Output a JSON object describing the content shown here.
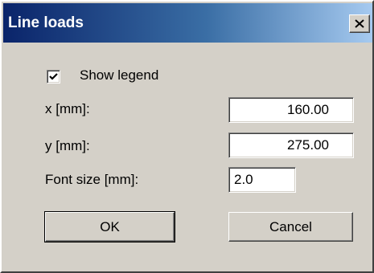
{
  "dialog": {
    "title": "Line loads",
    "close_icon": "close-icon"
  },
  "show_legend": {
    "label": "Show legend",
    "checked": true
  },
  "x_field": {
    "label": "x [mm]:",
    "value": "160.00"
  },
  "y_field": {
    "label": "y [mm]:",
    "value": "275.00"
  },
  "font_size_field": {
    "label": "Font size [mm]:",
    "value": "2.0"
  },
  "buttons": {
    "ok_label": "OK",
    "cancel_label": "Cancel"
  },
  "colors": {
    "titlebar_start": "#0a246a",
    "titlebar_end": "#a6caf0",
    "face": "#d4d0c8"
  }
}
